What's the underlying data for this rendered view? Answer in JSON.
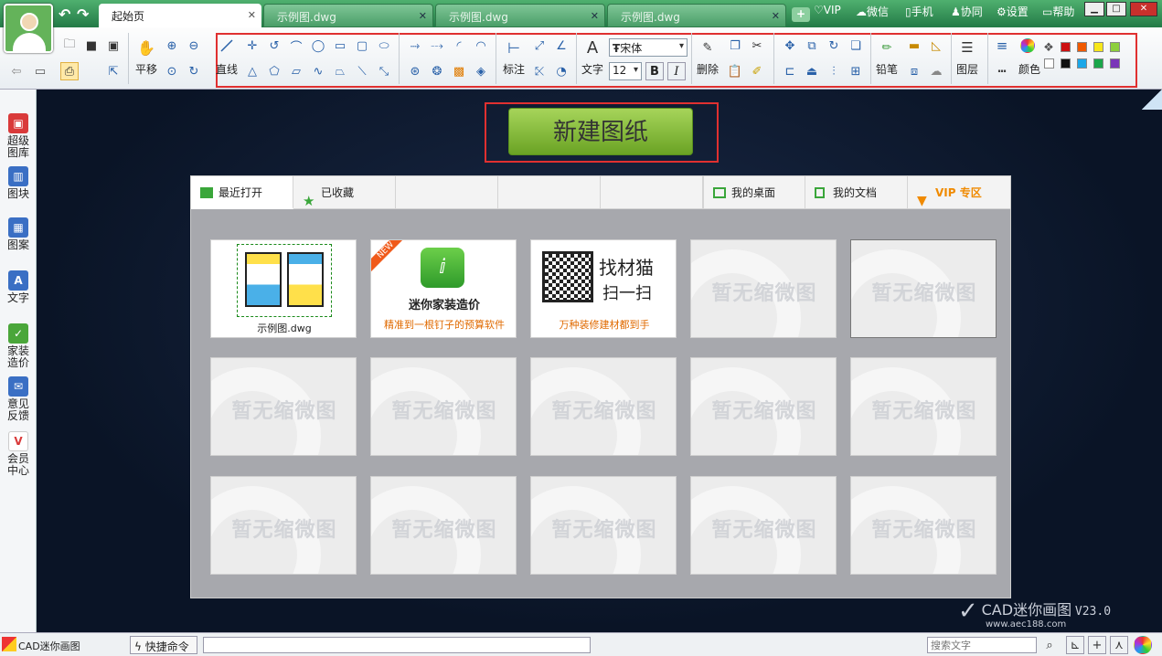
{
  "tabs": [
    {
      "label": "起始页",
      "active": true
    },
    {
      "label": "示例图.dwg",
      "active": false
    },
    {
      "label": "示例图.dwg",
      "active": false
    },
    {
      "label": "示例图.dwg",
      "active": false
    }
  ],
  "top_menu": {
    "vip": "VIP",
    "wechat": "微信",
    "phone": "手机",
    "collab": "协同",
    "settings": "设置",
    "help": "帮助"
  },
  "toolbar": {
    "pan": "平移",
    "line": "直线",
    "annotate": "标注",
    "text": "文字",
    "font_name": "宋体",
    "font_size": "12",
    "bold": "B",
    "italic": "I",
    "delete": "删除",
    "pencil": "铅笔",
    "layer": "图层",
    "color": "颜色"
  },
  "colors": [
    "#cc1111",
    "#f05a00",
    "#f7e71a",
    "#8ccf3c",
    "#ffffff",
    "#111111",
    "#1ba7e8",
    "#1aa64a",
    "#7a36b8"
  ],
  "left_nav": [
    {
      "label": "超级图库",
      "icon": "gallery-icon",
      "color": "#d93a3a"
    },
    {
      "label": "图块",
      "icon": "blocks-icon",
      "color": "#3a6fc4"
    },
    {
      "label": "图案",
      "icon": "pattern-icon",
      "color": "#3a6fc4"
    },
    {
      "label": "文字",
      "icon": "text-icon",
      "color": "#3a6fc4"
    },
    {
      "label": "家装造价",
      "icon": "cost-icon",
      "color": "#4aa63a"
    },
    {
      "label": "意见反馈",
      "icon": "feedback-icon",
      "color": "#3a6fc4"
    },
    {
      "label": "会员中心",
      "icon": "vip-icon",
      "color": "#d93a3a"
    }
  ],
  "new_drawing": "新建图纸",
  "panel_tabs": {
    "recent": "最近打开",
    "favorites": "已收藏",
    "desktop": "我的桌面",
    "docs": "我的文档",
    "vip": "VIP 专区"
  },
  "thumbs": {
    "first_caption": "示例图.dwg",
    "ad1_badge": "NEW",
    "ad1_title": "迷你家装造价",
    "ad1_sub": "精准到一根钉子的预算软件",
    "ad2_title": "找材猫",
    "ad2_scan": "扫一扫",
    "ad2_sub": "万种装修建材都到手",
    "placeholder": "暂无缩微图"
  },
  "watermark": {
    "brand": "CAD迷你画图",
    "version": "V23.0",
    "url": "www.aec188.com"
  },
  "status": {
    "app": "CAD迷你画图",
    "quick_cmd": "快捷命令",
    "search_placeholder": "搜索文字"
  }
}
